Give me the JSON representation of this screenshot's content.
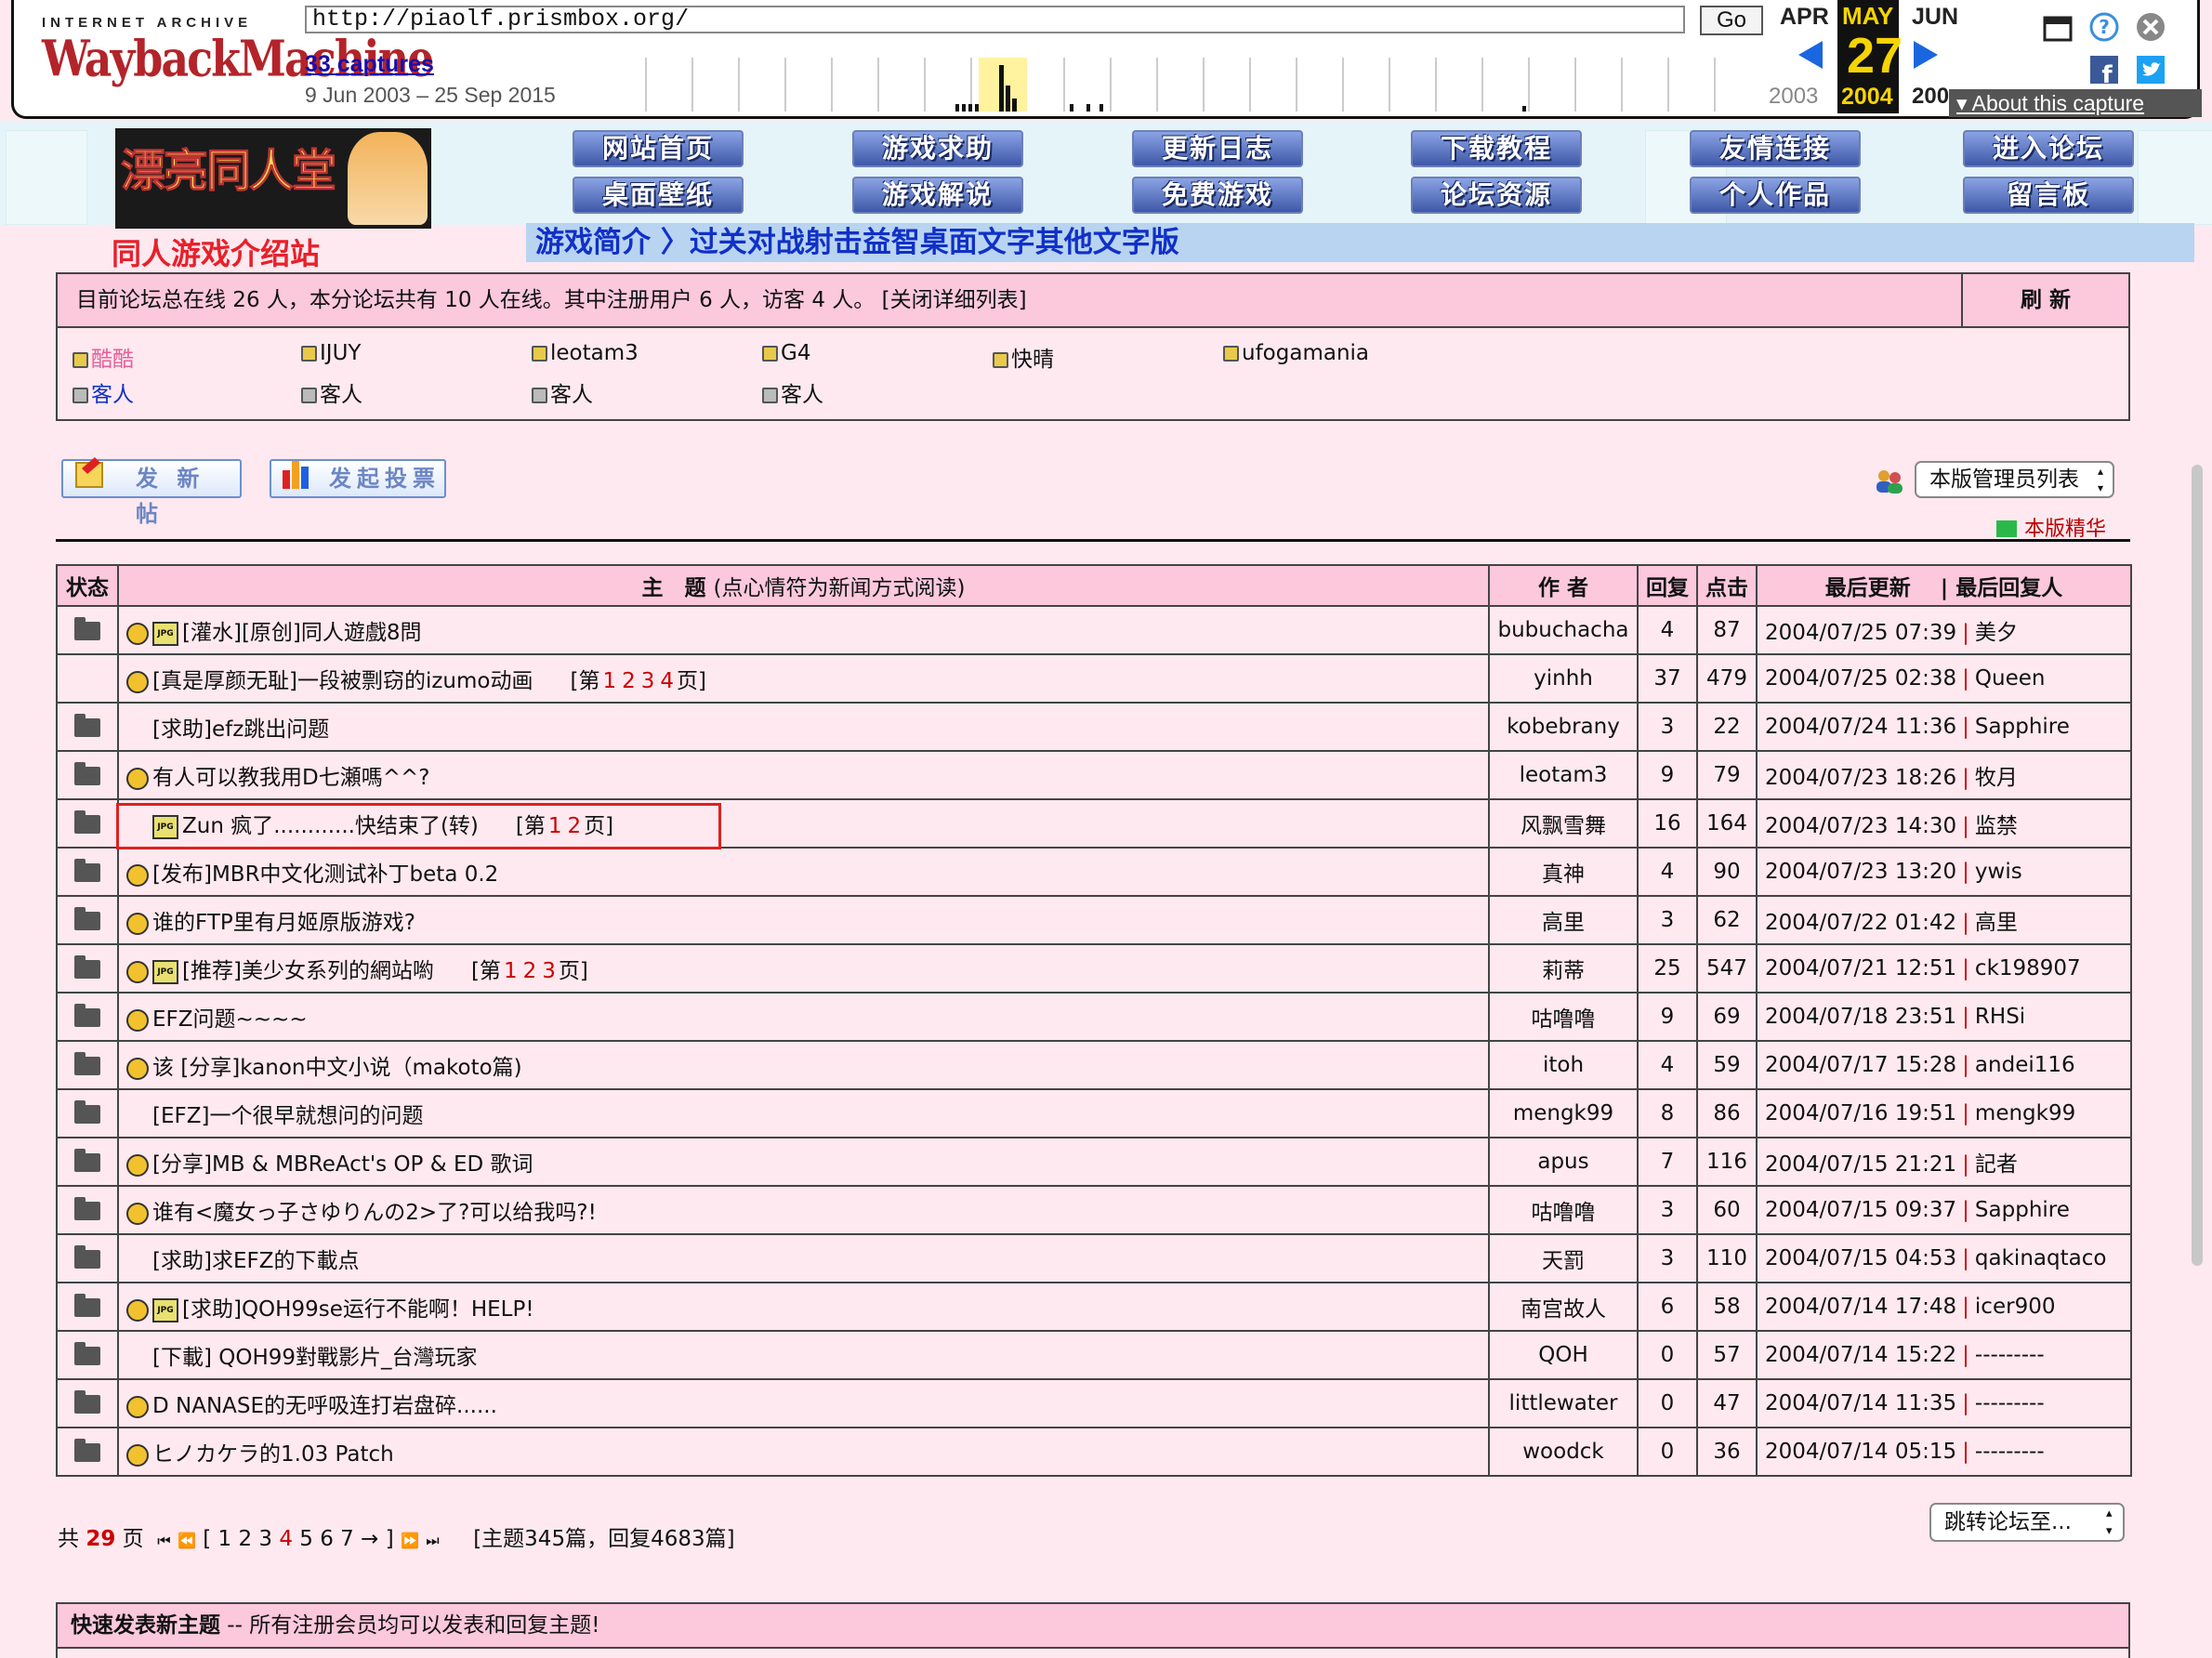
{
  "wayback": {
    "logo_top": "INTERNET ARCHIVE",
    "logo_main": "WaybackMachine",
    "url": "http://piaolf.prismbox.org/",
    "go_label": "Go",
    "captures": "33 captures",
    "date_range": "9 Jun 2003 – 25 Sep 2015",
    "prev_month": "APR",
    "cur_month": "MAY",
    "next_month": "JUN",
    "cur_day": "27",
    "prev_year": "2003",
    "cur_year": "2004",
    "next_year": "200",
    "about": "▾ About this capture",
    "colors": {
      "highlight": "#f5d400",
      "arrow": "#1a66e0"
    }
  },
  "banner": {
    "logo_text": "漂亮同人堂",
    "nav": [
      "网站首页",
      "游戏求助",
      "更新日志",
      "下载教程",
      "友情连接",
      "进入论坛",
      "桌面壁纸",
      "游戏解说",
      "免费游戏",
      "论坛资源",
      "个人作品",
      "留言板"
    ],
    "section_title": "同人游戏介绍站",
    "sub_nav": "游戏简介 〉过关对战射击益智桌面文字其他文字版"
  },
  "online": {
    "summary": "目前论坛总在线 26 人，本分论坛共有 10 人在线。其中注册用户 6 人，访客 4 人。    [关闭详细列表]",
    "refresh": "刷 新",
    "users": [
      {
        "name": "酷酷",
        "color": "#e8609a"
      },
      {
        "name": "IJUY"
      },
      {
        "name": "leotam3"
      },
      {
        "name": "G4"
      },
      {
        "name": "快晴"
      },
      {
        "name": "ufogamania"
      },
      {
        "name": "客人",
        "color": "#1030c8"
      },
      {
        "name": "客人"
      },
      {
        "name": "客人"
      },
      {
        "name": "客人"
      }
    ]
  },
  "actions": {
    "new_post": "发 新 帖",
    "new_poll": "发起投票",
    "mod_list": "本版管理员列表",
    "jinghua": "本版精华"
  },
  "table": {
    "headers": {
      "status": "状态",
      "topic": "主　题",
      "topic_note": "(点心情符为新闻方式阅读)",
      "author": "作 者",
      "replies": "回复",
      "views": "点击",
      "last_update": "最后更新",
      "last_replier": "| 最后回复人"
    },
    "rows": [
      {
        "folder": true,
        "mood": true,
        "jpg": true,
        "title": "[灌水][原创]同人遊戲8問",
        "pages": "",
        "author": "bubuchacha",
        "replies": "4",
        "views": "87",
        "date": "2004/07/25 07:39",
        "last": "美夕"
      },
      {
        "folder": false,
        "mood": true,
        "jpg": false,
        "title": "[真是厚颜无耻]一段被剽窃的izumo动画",
        "pages": "1 2 3 4",
        "author": "yinhh",
        "replies": "37",
        "views": "479",
        "date": "2004/07/25 02:38",
        "last": "Queen"
      },
      {
        "folder": true,
        "mood": false,
        "jpg": false,
        "title": "[求助]efz跳出问题",
        "pages": "",
        "author": "kobebrany",
        "replies": "3",
        "views": "22",
        "date": "2004/07/24 11:36",
        "last": "Sapphire"
      },
      {
        "folder": true,
        "mood": true,
        "jpg": false,
        "title": "有人可以教我用D七瀬嗎^^?",
        "pages": "",
        "author": "leotam3",
        "replies": "9",
        "views": "79",
        "date": "2004/07/23 18:26",
        "last": "牧月"
      },
      {
        "folder": true,
        "mood": false,
        "jpg": true,
        "title": "Zun 疯了............快结束了(转)",
        "pages": "1 2",
        "author": "风飘雪舞",
        "replies": "16",
        "views": "164",
        "date": "2004/07/23 14:30",
        "last": "监禁"
      },
      {
        "folder": true,
        "mood": true,
        "jpg": false,
        "title": "[发布]MBR中文化测试补丁beta 0.2",
        "pages": "",
        "author": "真神",
        "replies": "4",
        "views": "90",
        "date": "2004/07/23 13:20",
        "last": "ywis"
      },
      {
        "folder": true,
        "mood": true,
        "jpg": false,
        "title": "谁的FTP里有月姬原版游戏?",
        "pages": "",
        "author": "高里",
        "replies": "3",
        "views": "62",
        "date": "2004/07/22 01:42",
        "last": "高里"
      },
      {
        "folder": true,
        "mood": true,
        "jpg": true,
        "title": "[推荐]美少女系列的網站喲",
        "pages": "1 2 3",
        "author": "莉蒂",
        "replies": "25",
        "views": "547",
        "date": "2004/07/21 12:51",
        "last": "ck198907"
      },
      {
        "folder": true,
        "mood": true,
        "jpg": false,
        "title": "EFZ问题~~~~",
        "pages": "",
        "author": "咕噜噜",
        "replies": "9",
        "views": "69",
        "date": "2004/07/18 23:51",
        "last": "RHSi"
      },
      {
        "folder": true,
        "mood": true,
        "jpg": false,
        "title": "该 [分享]kanon中文小说（makoto篇)",
        "pages": "",
        "author": "itoh",
        "replies": "4",
        "views": "59",
        "date": "2004/07/17 15:28",
        "last": "andei116"
      },
      {
        "folder": true,
        "mood": false,
        "jpg": false,
        "title": "[EFZ]一个很早就想问的问题",
        "pages": "",
        "author": "mengk99",
        "replies": "8",
        "views": "86",
        "date": "2004/07/16 19:51",
        "last": "mengk99"
      },
      {
        "folder": true,
        "mood": true,
        "jpg": false,
        "title": "[分享]MB & MBReAct's OP & ED 歌词",
        "pages": "",
        "author": "apus",
        "replies": "7",
        "views": "116",
        "date": "2004/07/15 21:21",
        "last": "記者"
      },
      {
        "folder": true,
        "mood": true,
        "jpg": false,
        "title": "谁有<魔女っ子さゆりんの2>了?可以给我吗?!",
        "pages": "",
        "author": "咕噜噜",
        "replies": "3",
        "views": "60",
        "date": "2004/07/15 09:37",
        "last": "Sapphire"
      },
      {
        "folder": true,
        "mood": false,
        "jpg": false,
        "title": "[求助]求EFZ的下載点",
        "pages": "",
        "author": "天罰",
        "replies": "3",
        "views": "110",
        "date": "2004/07/15 04:53",
        "last": "qakinaqtaco"
      },
      {
        "folder": true,
        "mood": true,
        "jpg": true,
        "title": "[求助]QOH99se运行不能啊！HELP!",
        "pages": "",
        "author": "南宫故人",
        "replies": "6",
        "views": "58",
        "date": "2004/07/14 17:48",
        "last": "icer900"
      },
      {
        "folder": true,
        "mood": false,
        "jpg": false,
        "title": "[下載] QOH99對戰影片_台灣玩家",
        "pages": "",
        "author": "QOH",
        "replies": "0",
        "views": "57",
        "date": "2004/07/14 15:22",
        "last": "---------"
      },
      {
        "folder": true,
        "mood": true,
        "jpg": false,
        "title": "D NANASE的无呼吸连打岩盘碎......",
        "pages": "",
        "author": "littlewater",
        "replies": "0",
        "views": "47",
        "date": "2004/07/14 11:35",
        "last": "---------"
      },
      {
        "folder": true,
        "mood": true,
        "jpg": false,
        "title": "ヒノカケラ的1.03 Patch",
        "pages": "",
        "author": "woodck",
        "replies": "0",
        "views": "36",
        "date": "2004/07/14 05:15",
        "last": "---------"
      }
    ]
  },
  "pager": {
    "prefix": "共",
    "total": "29",
    "suffix": "页",
    "nav_first": "⏮",
    "nav_prev": "⏪",
    "pages_before": "[ 1 2 3",
    "current": "4",
    "pages_after": "5 6 7 → ]",
    "nav_next": "⏩",
    "nav_last": "⏭",
    "stats": "[主题345篇，回复4683篇]",
    "jump": "跳转论坛至..."
  },
  "quick": {
    "title": "快速发表新主题",
    "note": " -- 所有注册会员均可以发表和回复主题!"
  }
}
